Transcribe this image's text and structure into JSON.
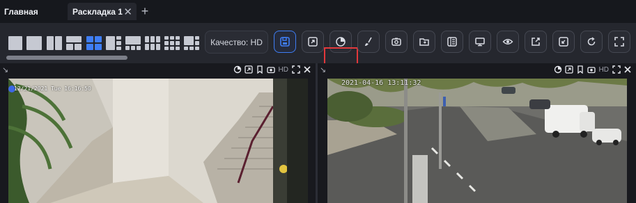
{
  "tabs": [
    {
      "label": "Главная"
    },
    {
      "label": "Раскладка 1",
      "close": "✕"
    }
  ],
  "add_tab": "+",
  "toolbar": {
    "quality_label": "Качество: HD",
    "layout_count": 9,
    "active_layout_index": 5,
    "buttons": [
      "save-icon",
      "expand-icon",
      "timeline-icon",
      "brush-icon",
      "camera-icon",
      "folder-icon",
      "archive-icon",
      "monitor-icon",
      "eye-icon",
      "export-icon",
      "shrink-icon",
      "refresh-icon",
      "fullscreen-icon"
    ]
  },
  "panels": {
    "left": {
      "quality": "HD",
      "osd_time": "12/21/2021 Tue 16:16:50"
    },
    "right": {
      "quality": "HD",
      "osd_time": "2021-04-16 13:11:32"
    }
  },
  "colors": {
    "accent": "#3f7ef5",
    "highlight": "#e2383b"
  }
}
